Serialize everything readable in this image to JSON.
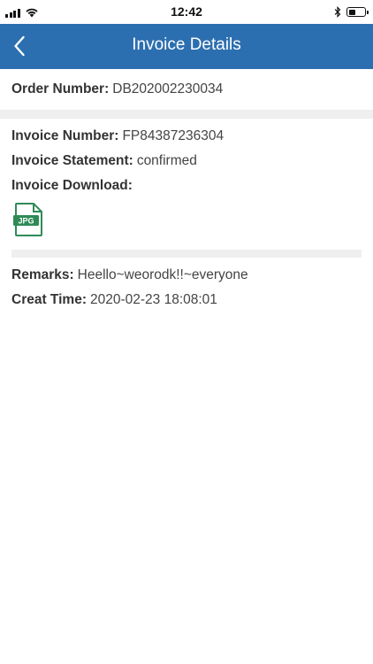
{
  "status_bar": {
    "time": "12:42",
    "battery_level": 0.45
  },
  "nav": {
    "title": "Invoice Details"
  },
  "order": {
    "label": "Order Number:",
    "value": "DB202002230034"
  },
  "invoice": {
    "number_label": "Invoice Number:",
    "number_value": "FP84387236304",
    "statement_label": "Invoice Statement:",
    "statement_value": "confirmed",
    "download_label": "Invoice Download:",
    "file_type": "JPG",
    "file_icon": "jpg-file-icon"
  },
  "remarks": {
    "label": "Remarks:",
    "value": "Heello~weorodk!!~everyone"
  },
  "created": {
    "label": "Creat Time:",
    "value": "2020-02-23 18:08:01"
  },
  "colors": {
    "nav_bg": "#2c6fb0",
    "file_green": "#2e8b57",
    "separator": "#efefef"
  }
}
